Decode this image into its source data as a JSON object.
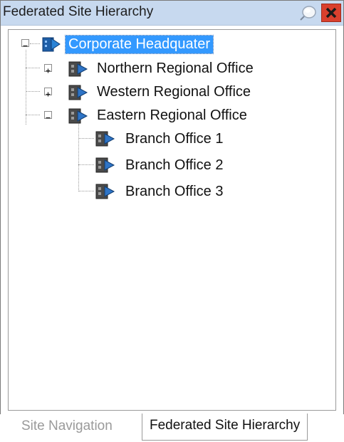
{
  "window": {
    "title": "Federated Site Hierarchy",
    "pin_icon": "pin-icon",
    "close_icon": "close-icon"
  },
  "tree": {
    "root": {
      "label": "Corporate Headquater",
      "expanded": true,
      "selected": true,
      "icon": "site-icon"
    },
    "children": [
      {
        "label": "Northern Regional Office",
        "expanded": false,
        "icon": "site-icon"
      },
      {
        "label": "Western Regional Office",
        "expanded": false,
        "icon": "site-icon"
      },
      {
        "label": "Eastern Regional Office",
        "expanded": true,
        "icon": "site-icon",
        "children": [
          {
            "label": "Branch Office 1",
            "icon": "site-icon"
          },
          {
            "label": "Branch Office 2",
            "icon": "site-icon"
          },
          {
            "label": "Branch Office 3",
            "icon": "site-icon"
          }
        ]
      }
    ]
  },
  "tabs": [
    {
      "label": "Site Navigation",
      "active": false
    },
    {
      "label": "Federated Site Hierarchy",
      "active": true
    }
  ],
  "colors": {
    "titlebar": "#c7d9ef",
    "selection": "#3399ff",
    "close_button": "#d9402e"
  }
}
